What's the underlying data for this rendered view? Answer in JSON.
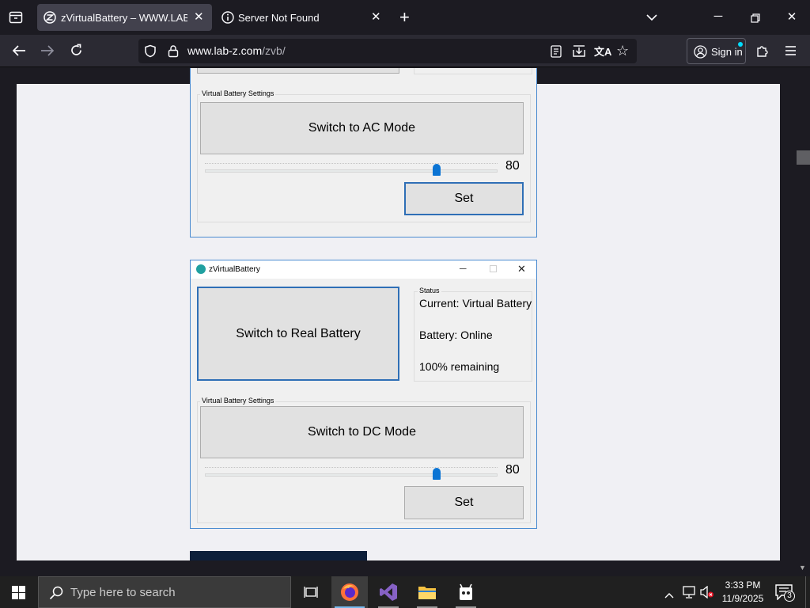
{
  "browser": {
    "tabs": [
      {
        "title": "zVirtualBattery – WWW.LAB-Z.C",
        "active": true,
        "icon": "lab-z-favicon-icon"
      },
      {
        "title": "Server Not Found",
        "active": false,
        "icon": "info-icon"
      }
    ],
    "url": {
      "host": "www.lab-z.com",
      "path": "/zvb/"
    },
    "sign_in_label": "Sign in"
  },
  "windows": {
    "top": {
      "settings_group_label": "Virtual Battery Settings",
      "mode_button_label": "Switch to AC Mode",
      "slider_value": "80",
      "set_button_label": "Set"
    },
    "bottom": {
      "title": "zVirtualBattery",
      "battery_button_label": "Switch to Real Battery",
      "status_group_label": "Status",
      "status_current": "Current: Virtual Battery",
      "status_battery": "Battery: Online",
      "status_remaining": "100% remaining",
      "settings_group_label": "Virtual Battery Settings",
      "mode_button_label": "Switch to DC Mode",
      "slider_value": "80",
      "set_button_label": "Set"
    }
  },
  "taskbar": {
    "search_placeholder": "Type here to search",
    "time": "3:33 PM",
    "date": "11/9/2025",
    "notification_count": "3"
  },
  "colors": {
    "accent": "#0b74d4",
    "window_border": "#4a8bd0",
    "page_bg": "#f0f0f4"
  }
}
